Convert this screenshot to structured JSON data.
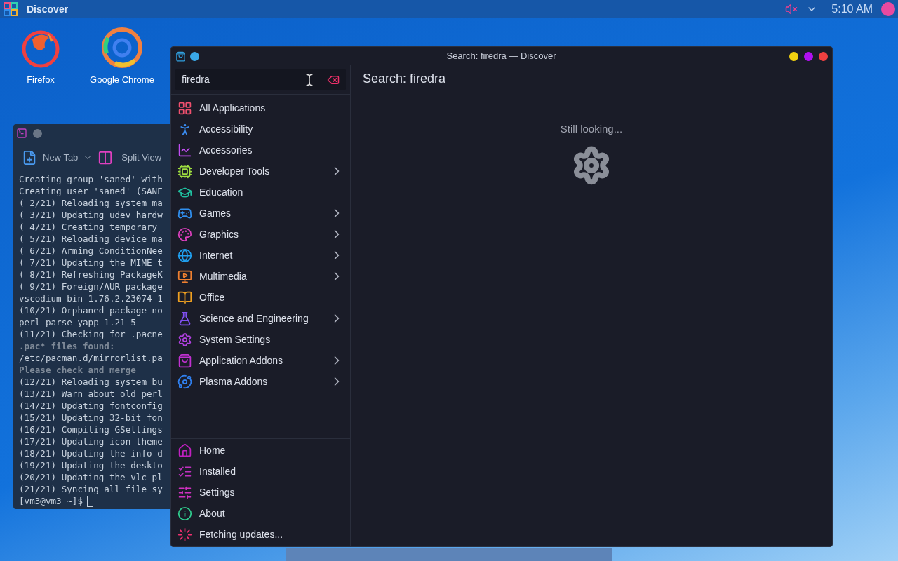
{
  "panel": {
    "app_title": "Discover",
    "time": "5:10 AM"
  },
  "desktop_icons": [
    {
      "label": "Firefox"
    },
    {
      "label": "Google Chrome"
    }
  ],
  "terminal": {
    "toolbar": [
      "New Tab",
      "Split View"
    ],
    "lines": [
      {
        "text": "Creating group 'saned' with",
        "dim": false
      },
      {
        "text": "Creating user 'saned' (SANE",
        "dim": false
      },
      {
        "text": "( 2/21) Reloading system ma",
        "dim": false
      },
      {
        "text": "( 3/21) Updating udev hardw",
        "dim": false
      },
      {
        "text": "( 4/21) Creating temporary",
        "dim": false
      },
      {
        "text": "( 5/21) Reloading device ma",
        "dim": false
      },
      {
        "text": "( 6/21) Arming ConditionNee",
        "dim": false
      },
      {
        "text": "( 7/21) Updating the MIME t",
        "dim": false
      },
      {
        "text": "( 8/21) Refreshing PackageK",
        "dim": false
      },
      {
        "text": "( 9/21) Foreign/AUR package",
        "dim": false
      },
      {
        "text": "vscodium-bin 1.76.2.23074-1",
        "dim": false
      },
      {
        "text": "(10/21) Orphaned package no",
        "dim": false
      },
      {
        "text": "perl-parse-yapp 1.21-5",
        "dim": false
      },
      {
        "text": "(11/21) Checking for .pacne",
        "dim": false
      },
      {
        "text": ".pac* files found:",
        "dim": true
      },
      {
        "text": "/etc/pacman.d/mirrorlist.pa",
        "dim": false
      },
      {
        "text": "Please check and merge",
        "dim": true
      },
      {
        "text": "(12/21) Reloading system bu",
        "dim": false
      },
      {
        "text": "(13/21) Warn about old perl",
        "dim": false
      },
      {
        "text": "(14/21) Updating fontconfig",
        "dim": false
      },
      {
        "text": "(15/21) Updating 32-bit fon",
        "dim": false
      },
      {
        "text": "(16/21) Compiling GSettings",
        "dim": false
      },
      {
        "text": "(17/21) Updating icon theme",
        "dim": false
      },
      {
        "text": "(18/21) Updating the info d",
        "dim": false
      },
      {
        "text": "(19/21) Updating the deskto",
        "dim": false
      },
      {
        "text": "(20/21) Updating the vlc pl",
        "dim": false
      },
      {
        "text": "(21/21) Syncing all file sy",
        "dim": false
      }
    ],
    "prompt": "[vm3@vm3 ~]$"
  },
  "discover": {
    "title": "Search: firedra — Discover",
    "search": {
      "value": "firedra"
    },
    "categories": [
      {
        "label": "All Applications",
        "has_children": false
      },
      {
        "label": "Accessibility",
        "has_children": false
      },
      {
        "label": "Accessories",
        "has_children": false
      },
      {
        "label": "Developer Tools",
        "has_children": true
      },
      {
        "label": "Education",
        "has_children": false
      },
      {
        "label": "Games",
        "has_children": true
      },
      {
        "label": "Graphics",
        "has_children": true
      },
      {
        "label": "Internet",
        "has_children": true
      },
      {
        "label": "Multimedia",
        "has_children": true
      },
      {
        "label": "Office",
        "has_children": false
      },
      {
        "label": "Science and Engineering",
        "has_children": true
      },
      {
        "label": "System Settings",
        "has_children": false
      },
      {
        "label": "Application Addons",
        "has_children": true
      },
      {
        "label": "Plasma Addons",
        "has_children": true
      }
    ],
    "nav": [
      {
        "label": "Home"
      },
      {
        "label": "Installed"
      },
      {
        "label": "Settings"
      },
      {
        "label": "About"
      },
      {
        "label": "Fetching updates..."
      }
    ],
    "page_title": "Search: firedra",
    "status": "Still looking..."
  }
}
